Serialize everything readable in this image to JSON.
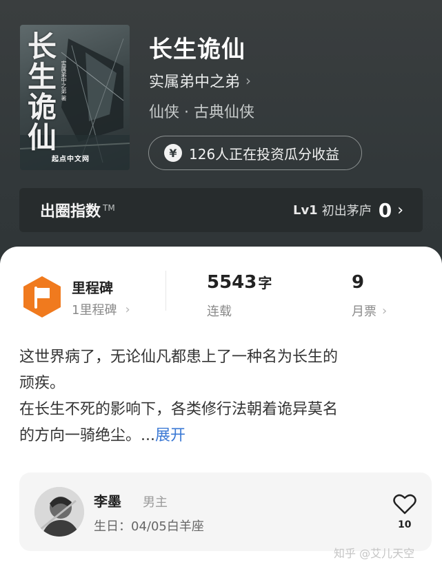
{
  "book": {
    "title": "长生诡仙",
    "author": "实属弟中之弟",
    "genre": "仙侠 · 古典仙侠",
    "invest_text": "126人正在投资瓜分收益",
    "cover": {
      "title_chars": "长生诡仙",
      "author_small": "实属弟中之弟 著",
      "publisher": "起点中文网"
    }
  },
  "index": {
    "label": "出圈指数",
    "tm": "TM",
    "level": "Lv1",
    "level_name": "初出茅庐",
    "score": "0"
  },
  "stats": {
    "milestone_title": "里程碑",
    "milestone_sub": "1里程碑",
    "words_value": "5543",
    "words_unit": "字",
    "words_label": "连载",
    "votes_value": "9",
    "votes_label": "月票"
  },
  "synopsis": {
    "line1": "这世界病了，无论仙凡都患上了一种名为长生的",
    "line2": "顽疾。",
    "line3": "在长生不死的影响下，各类修行法朝着诡异莫名",
    "line4": "的方向一骑绝尘。...",
    "expand": "展开"
  },
  "author_card": {
    "name": "李墨",
    "gender": "男主",
    "birthday": "生日：04/05白羊座",
    "likes": "10"
  },
  "watermark": "知乎 @艾儿天空",
  "colors": {
    "header_bg": "#32383a",
    "accent_orange": "#f07a1e",
    "link_blue": "#3a78d4"
  }
}
